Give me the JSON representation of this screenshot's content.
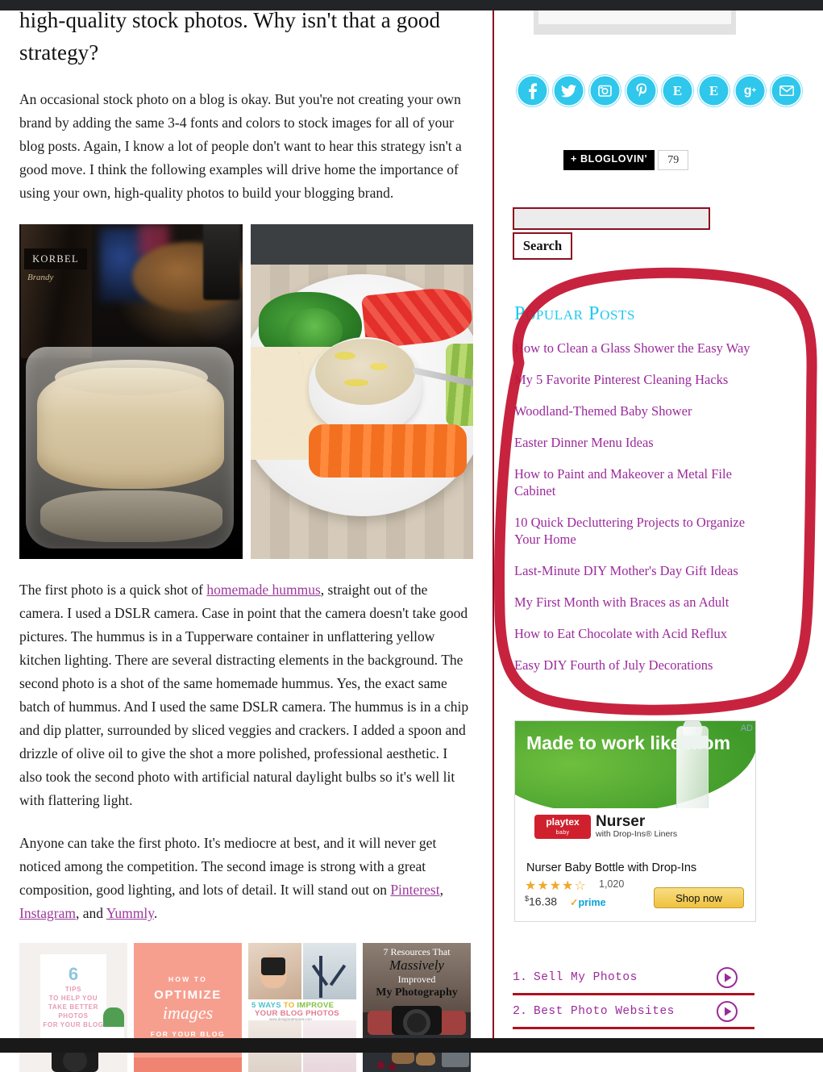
{
  "article": {
    "heading": "high-quality stock photos. Why isn't that a good strategy?",
    "paragraph1": "An occasional stock photo on a blog is okay. But you're not creating your own brand by adding the same 3-4 fonts and colors to stock images for all of your blog posts. Again, I know a lot of people don't want to hear this strategy isn't a good move. I think the following examples will drive home the importance of using your own, high-quality photos to build your blogging brand.",
    "paragraph2_a": "The first photo is a quick shot of ",
    "paragraph2_link": "homemade hummus",
    "paragraph2_b": ", straight out of the camera. I used a DSLR camera. Case in point that the camera doesn't take good pictures. The hummus is in a Tupperware container in unflattering yellow kitchen lighting. There are several distracting elements in the background. The second photo is a shot of the same homemade hummus. Yes, the exact same batch of hummus. And I used the same DSLR camera. The hummus is in a chip and dip platter, surrounded by sliced veggies and crackers. I added a spoon and drizzle of olive oil to give the shot a more polished, professional aesthetic. I also took the second photo with artificial natural daylight bulbs so it's well lit with flattering light.",
    "paragraph3_a": "Anyone can take the first photo. It's mediocre at best, and it will never get noticed among the competition. The second image is strong with a great composition, good lighting, and lots of detail. It will stand out on ",
    "paragraph3_link1": "Pinterest",
    "paragraph3_mid1": ", ",
    "paragraph3_link2": "Instagram",
    "paragraph3_mid2": ", and ",
    "paragraph3_link3": "Yummly",
    "paragraph3_end": "."
  },
  "photos": {
    "photo1_alt": "hummus in tupperware container dark kitchen photo",
    "photo1_label": "KORBEL",
    "photo1_label2": "Brandy",
    "photo2_alt": "hummus chip and dip platter with veggies and crackers"
  },
  "graphics": {
    "card1": {
      "number": "6",
      "text": "TIPS\nTO HELP YOU\nTAKE BETTER\nPHOTOS\nFOR YOUR BLOG"
    },
    "card2": {
      "kicker": "HOW TO",
      "line1": "OPTIMIZE",
      "line2": "images",
      "line3": "FOR YOUR BLOG"
    },
    "card3": {
      "line1_a": "5 WAYS ",
      "line1_b": "TO ",
      "line1_c": "IMPROVE",
      "line2": "YOUR BLOG PHOTOS",
      "url": "www.designeatrepeat.com"
    },
    "card4": {
      "line1": "7 Resources That",
      "line2": "Massively",
      "line3": "Improved",
      "line4": "My Photography"
    }
  },
  "sidebar": {
    "social": [
      {
        "name": "facebook",
        "glyph": "f"
      },
      {
        "name": "twitter",
        "glyph": "t"
      },
      {
        "name": "instagram",
        "glyph": "i"
      },
      {
        "name": "pinterest",
        "glyph": "P"
      },
      {
        "name": "bloglovin",
        "glyph": "E"
      },
      {
        "name": "etsy",
        "glyph": "E"
      },
      {
        "name": "google-plus",
        "glyph": "g+"
      },
      {
        "name": "email",
        "glyph": "m"
      }
    ],
    "bloglovin": {
      "label": "+ BLOGLOVIN'",
      "count": "79"
    },
    "search": {
      "value": "",
      "placeholder": "",
      "button_label": "Search"
    },
    "popular_posts": {
      "title": "Popular Posts",
      "items": [
        "How to Clean a Glass Shower the Easy Way",
        "My 5 Favorite Pinterest Cleaning Hacks",
        "Woodland-Themed Baby Shower",
        "Easter Dinner Menu Ideas",
        "How to Paint and Makeover a Metal File Cabinet",
        "10 Quick Decluttering Projects to Organize Your Home",
        "Last-Minute DIY Mother's Day Gift Ideas",
        "My First Month with Braces as an Adult",
        "How to Eat Chocolate with Acid Reflux",
        "Easy DIY Fourth of July Decorations"
      ]
    },
    "ad": {
      "flag": "AD",
      "headline": "Made to work like mom",
      "brand": "playtex",
      "brand_sub": "baby",
      "product_line": "Nurser",
      "product_sub": "with Drop-Ins® Liners",
      "title": "Nurser Baby Bottle with Drop-Ins",
      "stars": "★★★★☆",
      "rating_count": "1,020",
      "price_currency": "$",
      "price": "16.38",
      "prime_check": "✓",
      "prime": "prime",
      "cta": "Shop now"
    },
    "nav_items": [
      {
        "num": "1.",
        "label": "Sell My Photos"
      },
      {
        "num": "2.",
        "label": "Best Photo Websites"
      }
    ]
  },
  "colors": {
    "accent_cyan": "#1ec9ef",
    "link_purple": "#9b2a9b",
    "divider_maroon": "#8b1020",
    "annotation_red": "#c31230",
    "topbar_dark": "#232428"
  }
}
